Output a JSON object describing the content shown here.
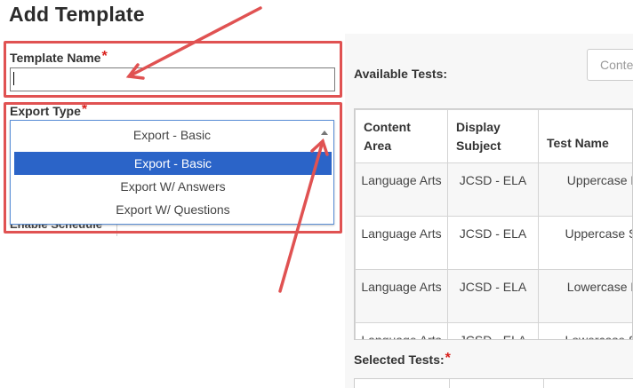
{
  "page": {
    "title": "Add Template"
  },
  "form": {
    "template_name": {
      "label": "Template Name",
      "required": "*",
      "value": ""
    },
    "export_type": {
      "label": "Export Type",
      "required": "*",
      "current": "Export - Basic",
      "options": [
        "Export - Basic",
        "Export W/ Answers",
        "Export W/ Questions"
      ],
      "selected_index": 0
    },
    "enable_schedule": {
      "label": "Enable Schedule"
    }
  },
  "available_tests": {
    "label": "Available Tests:",
    "search_placeholder": "Content",
    "columns": [
      "Content Area",
      "Display Subject",
      "Test Name"
    ],
    "rows": [
      [
        "Language Arts",
        "JCSD - ELA",
        "Uppercase Letters"
      ],
      [
        "Language Arts",
        "JCSD - ELA",
        "Uppercase Sounds"
      ],
      [
        "Language Arts",
        "JCSD - ELA",
        "Lowercase Letters"
      ],
      [
        "Language Arts",
        "JCSD - ELA",
        "Lowercase Sounds"
      ]
    ]
  },
  "selected_tests": {
    "label": "Selected Tests:",
    "required": "*"
  },
  "colors": {
    "highlight": "#e05252",
    "selected_option": "#2b64c8",
    "required_star": "#d9201c"
  }
}
